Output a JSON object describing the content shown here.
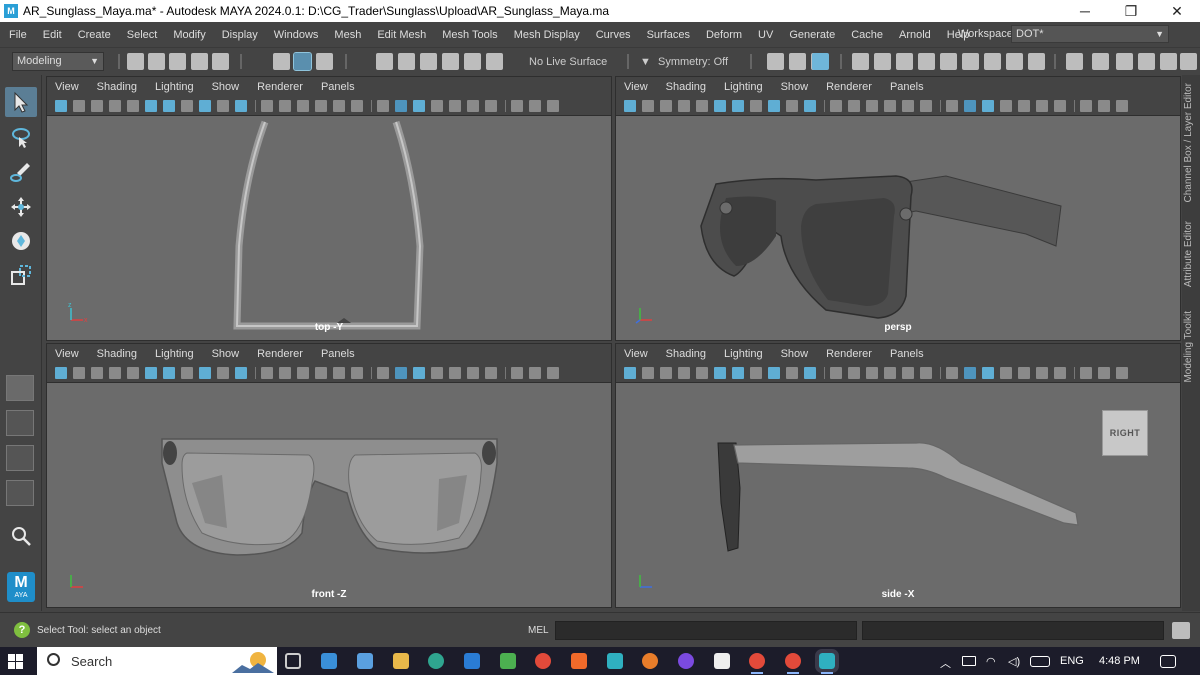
{
  "window": {
    "title": "AR_Sunglass_Maya.ma* - Autodesk MAYA 2024.0.1: D:\\CG_Trader\\Sunglass\\Upload\\AR_Sunglass_Maya.ma",
    "app_icon": "M",
    "minimize": "─",
    "maximize": "❐",
    "close": "✕"
  },
  "menubar": {
    "items": [
      "File",
      "Edit",
      "Create",
      "Select",
      "Modify",
      "Display",
      "Windows",
      "Mesh",
      "Edit Mesh",
      "Mesh Tools",
      "Mesh Display",
      "Curves",
      "Surfaces",
      "Deform",
      "UV",
      "Generate",
      "Cache",
      "Arnold",
      "Help"
    ],
    "workspace_label": "Workspace:",
    "workspace_value": "DOT*"
  },
  "statusline": {
    "mode": "Modeling",
    "live_surface": "No Live Surface",
    "symmetry": "Symmetry: Off"
  },
  "viewport_menu": [
    "View",
    "Shading",
    "Lighting",
    "Show",
    "Renderer",
    "Panels"
  ],
  "viewports": {
    "top": {
      "label": "top -Y"
    },
    "persp": {
      "label": "persp"
    },
    "front": {
      "label": "front -Z"
    },
    "side": {
      "label": "side -X",
      "viewcube": "RIGHT"
    }
  },
  "right_tabs": [
    "Channel Box / Layer Editor",
    "Attribute Editor",
    "Modeling Toolkit"
  ],
  "helpline": {
    "help_text": "Select Tool: select an object",
    "mel_label": "MEL"
  },
  "taskbar": {
    "search_text": "Search",
    "language": "ENG",
    "time": "4:48 PM"
  },
  "toolbox": {
    "logo_text": "AYA"
  }
}
